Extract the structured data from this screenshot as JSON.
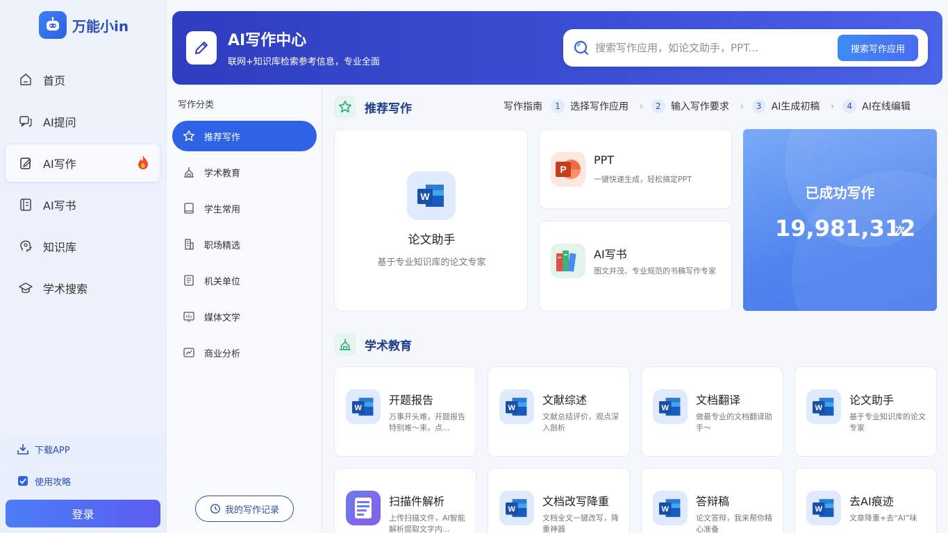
{
  "brand": {
    "name": "万能小in"
  },
  "nav": {
    "items": [
      {
        "label": "首页"
      },
      {
        "label": "AI提问"
      },
      {
        "label": "AI写作"
      },
      {
        "label": "AI写书"
      },
      {
        "label": "知识库"
      },
      {
        "label": "学术搜索"
      }
    ],
    "download_label": "下载APP",
    "guide_label": "使用攻略",
    "login_label": "登录"
  },
  "header": {
    "title": "AI写作中心",
    "subtitle": "联网+知识库检索参考信息，专业全面",
    "search_placeholder": "搜索写作应用，如论文助手，PPT...",
    "search_button": "搜索写作应用"
  },
  "categories": {
    "title": "写作分类",
    "items": [
      {
        "label": "推荐写作"
      },
      {
        "label": "学术教育"
      },
      {
        "label": "学生常用"
      },
      {
        "label": "职场精选"
      },
      {
        "label": "机关单位"
      },
      {
        "label": "媒体文学"
      },
      {
        "label": "商业分析"
      }
    ],
    "history_label": "我的写作记录"
  },
  "recommended": {
    "title": "推荐写作",
    "guide": {
      "label": "写作指南",
      "steps": [
        {
          "num": "1",
          "label": "选择写作应用"
        },
        {
          "num": "2",
          "label": "输入写作要求"
        },
        {
          "num": "3",
          "label": "AI生成初稿"
        },
        {
          "num": "4",
          "label": "AI在线编辑"
        }
      ]
    },
    "feature": {
      "title": "论文助手",
      "desc": "基于专业知识库的论文专家"
    },
    "ppt": {
      "title": "PPT",
      "desc": "一键快速生成，轻松搞定PPT"
    },
    "book": {
      "title": "AI写书",
      "desc": "图文并茂、专业规范的书稿写作专家"
    },
    "stats": {
      "label": "已成功写作",
      "count": "19,981,312",
      "unit": "次"
    }
  },
  "academic": {
    "title": "学术教育",
    "cards": [
      {
        "title": "开题报告",
        "desc": "万事开头难，开题报告特别难～来，点..."
      },
      {
        "title": "文献综述",
        "desc": "文献总结评价，观点深入剖析"
      },
      {
        "title": "文档翻译",
        "desc": "做最专业的文档翻译助手～"
      },
      {
        "title": "论文助手",
        "desc": "基于专业知识库的论文专家"
      },
      {
        "title": "扫描件解析",
        "desc": "上传扫描文件，AI智能解析提取文字内..."
      },
      {
        "title": "文档改写降重",
        "desc": "文档全文一键改写，降重神器"
      },
      {
        "title": "答辩稿",
        "desc": "论文答辩，我来帮你精心准备"
      },
      {
        "title": "去AI痕迹",
        "desc": "文章降重+去“AI”味"
      }
    ]
  },
  "colors": {
    "accent": "#2f63e6",
    "brand": "#2a4fb6",
    "banner": "#3b4fd4"
  }
}
